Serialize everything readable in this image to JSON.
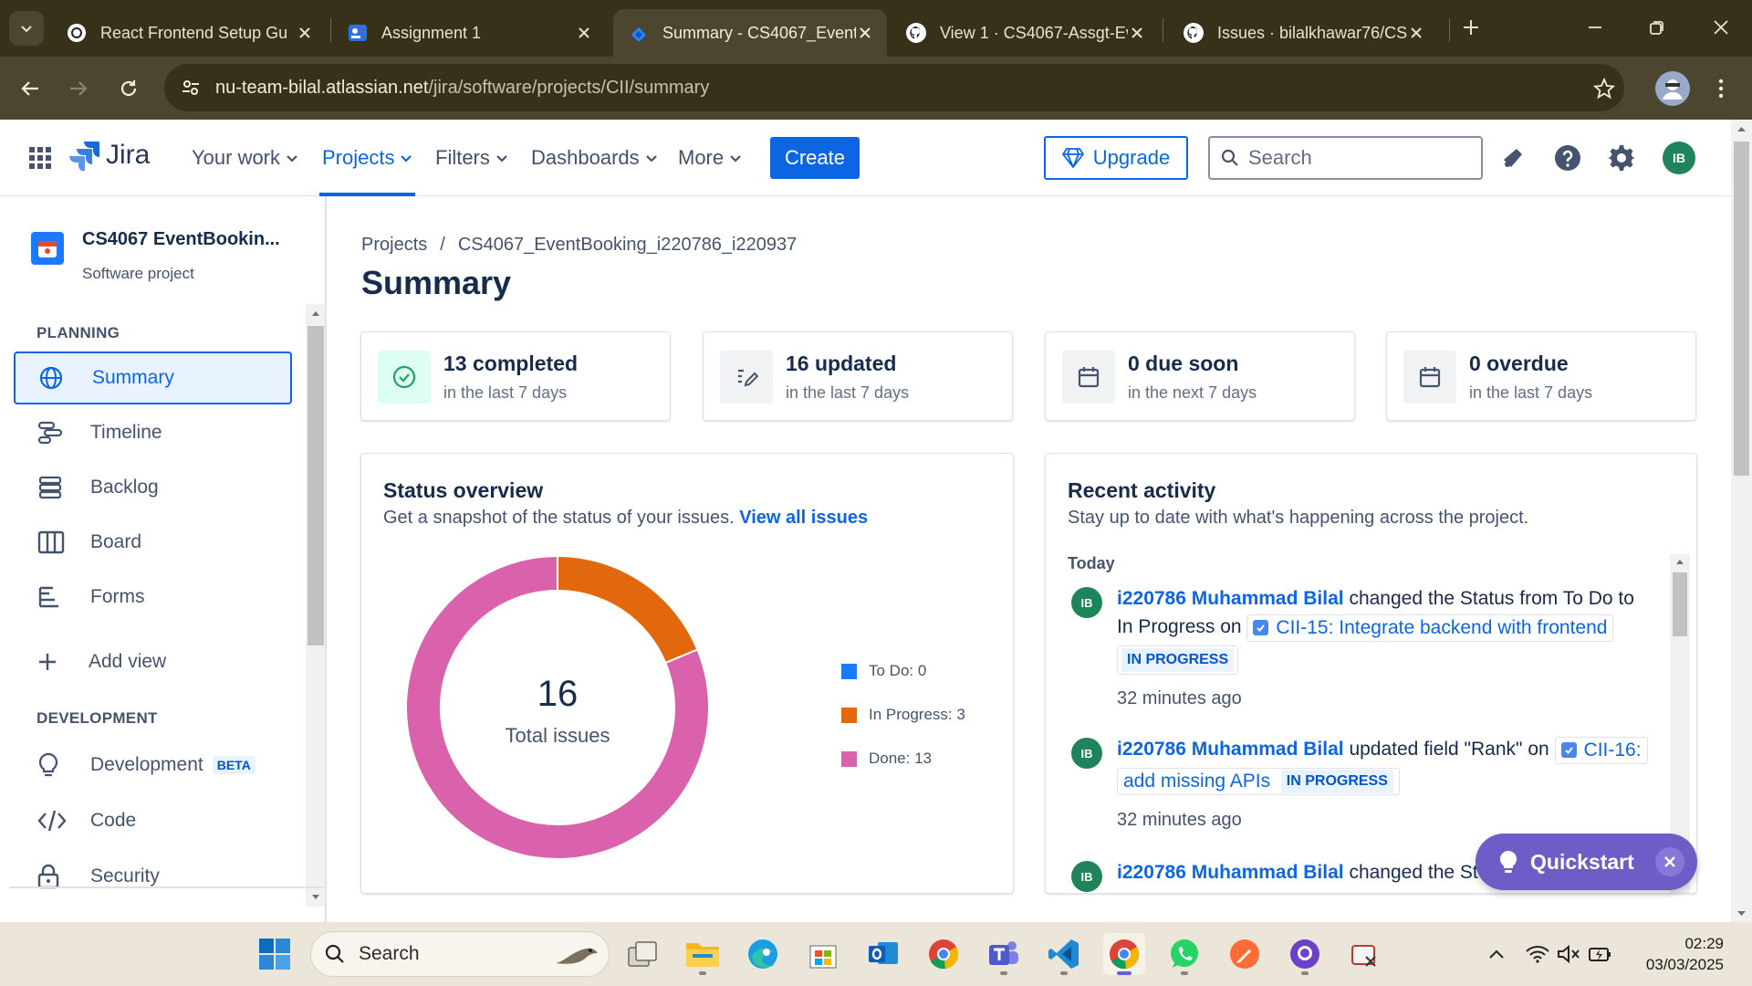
{
  "browser": {
    "tabs": [
      {
        "title": "React Frontend Setup Gu",
        "icon": "openai-icon",
        "active": false
      },
      {
        "title": "Assignment 1",
        "icon": "document-icon",
        "active": false
      },
      {
        "title": "Summary - CS4067_Event",
        "icon": "jira-icon",
        "active": true
      },
      {
        "title": "View 1 · CS4067-Assgt-Ev",
        "icon": "github-icon",
        "active": false
      },
      {
        "title": "Issues · bilalkhawar76/CS",
        "icon": "github-icon",
        "active": false
      }
    ],
    "url_host": "nu-team-bilal.atlassian.net",
    "url_path": "/jira/software/projects/CII/summary"
  },
  "header": {
    "logo_text": "Jira",
    "nav": [
      {
        "label": "Your work",
        "active": false
      },
      {
        "label": "Projects",
        "active": true
      },
      {
        "label": "Filters",
        "active": false
      },
      {
        "label": "Dashboards",
        "active": false
      },
      {
        "label": "More",
        "active": false
      }
    ],
    "create_label": "Create",
    "upgrade_label": "Upgrade",
    "search_placeholder": "Search",
    "avatar_initials": "IB"
  },
  "sidebar": {
    "project_name": "CS4067 EventBookin...",
    "project_type": "Software project",
    "planning_heading": "PLANNING",
    "planning_items": [
      {
        "label": "Summary",
        "icon": "globe-icon",
        "selected": true
      },
      {
        "label": "Timeline",
        "icon": "timeline-icon",
        "selected": false
      },
      {
        "label": "Backlog",
        "icon": "backlog-icon",
        "selected": false
      },
      {
        "label": "Board",
        "icon": "board-icon",
        "selected": false
      },
      {
        "label": "Forms",
        "icon": "forms-icon",
        "selected": false
      }
    ],
    "add_view_label": "Add view",
    "development_heading": "DEVELOPMENT",
    "development_items": [
      {
        "label": "Development",
        "badge": "BETA",
        "icon": "lightbulb-icon"
      },
      {
        "label": "Code",
        "icon": "code-icon"
      },
      {
        "label": "Security",
        "icon": "lock-icon"
      }
    ]
  },
  "main": {
    "breadcrumb": [
      "Projects",
      "CS4067_EventBooking_i220786_i220937"
    ],
    "title": "Summary",
    "stats": [
      {
        "main": "13 completed",
        "sub": "in the last 7 days",
        "icon": "check-circle-icon"
      },
      {
        "main": "16 updated",
        "sub": "in the last 7 days",
        "icon": "edit-icon"
      },
      {
        "main": "0 due soon",
        "sub": "in the next 7 days",
        "icon": "calendar-icon"
      },
      {
        "main": "0 overdue",
        "sub": "in the last 7 days",
        "icon": "calendar-icon"
      }
    ],
    "status_overview": {
      "title": "Status overview",
      "description": "Get a snapshot of the status of your issues.",
      "link": "View all issues",
      "total": "16",
      "total_label": "Total issues"
    },
    "recent_activity": {
      "title": "Recent activity",
      "description": "Stay up to date with what's happening across the project.",
      "day": "Today",
      "items": [
        {
          "initials": "IB",
          "user": "i220786 Muhammad Bilal",
          "action_1": "changed the Status from To Do to",
          "action_2": "In Progress on",
          "issue": "CII-15: Integrate backend with frontend",
          "status": "IN PROGRESS",
          "time": "32 minutes ago"
        },
        {
          "initials": "IB",
          "user": "i220786 Muhammad Bilal",
          "action_1": "updated field \"Rank\" on",
          "issue_a": "CII-16:",
          "issue_b": "add missing APIs",
          "status": "IN PROGRESS",
          "time": "32 minutes ago"
        },
        {
          "initials": "IB",
          "user": "i220786 Muhammad Bilal",
          "action_1": "changed the St"
        }
      ]
    }
  },
  "chart_data": {
    "type": "pie",
    "donut": true,
    "categories": [
      "To Do",
      "In Progress",
      "Done"
    ],
    "values": [
      0,
      3,
      13
    ],
    "legend_labels": [
      "To Do: 0",
      "In Progress: 3",
      "Done: 13"
    ],
    "colors": [
      "#1d7afc",
      "#e2680e",
      "#da62ac"
    ],
    "legend_position": "right"
  },
  "quickstart": {
    "label": "Quickstart"
  },
  "taskbar": {
    "search_label": "Search",
    "time": "02:29",
    "date": "03/03/2025"
  }
}
